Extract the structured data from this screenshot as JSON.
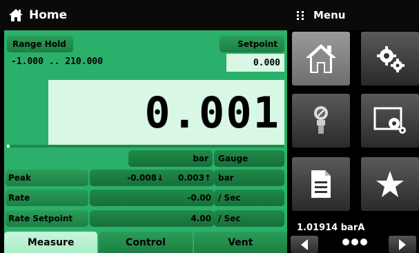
{
  "header": {
    "title": "Home"
  },
  "menu": {
    "title": "Menu"
  },
  "measure": {
    "range_hold_label": "Range Hold",
    "range_text": "-1.000 .. 210.000",
    "setpoint_label": "Setpoint",
    "setpoint_value": "0.000",
    "reading": "0.001",
    "unit": "bar",
    "mode": "Gauge",
    "progress_fraction": 0.01
  },
  "rows": [
    {
      "label": "Peak",
      "value": "-0.008↓     0.003↑",
      "unit": "bar"
    },
    {
      "label": "Rate",
      "value": "-0.00",
      "unit": "/ Sec"
    },
    {
      "label": "Rate Setpoint",
      "value": "4.00",
      "unit": "/ Sec"
    }
  ],
  "tabs": [
    {
      "label": "Measure",
      "active": true
    },
    {
      "label": "Control",
      "active": false
    },
    {
      "label": "Vent",
      "active": false
    }
  ],
  "tiles": [
    {
      "icon": "home-icon",
      "active": true
    },
    {
      "icon": "settings-gears-icon",
      "active": false
    },
    {
      "icon": "sensor-icon",
      "active": false
    },
    {
      "icon": "display-settings-icon",
      "active": false
    },
    {
      "icon": "document-icon",
      "active": false
    },
    {
      "icon": "star-icon",
      "active": false
    }
  ],
  "barometer": "1.01914 barA",
  "colors": {
    "panel": "#2ab06a",
    "highlight": "#d8f7e4",
    "header": "#0a0a0a"
  }
}
